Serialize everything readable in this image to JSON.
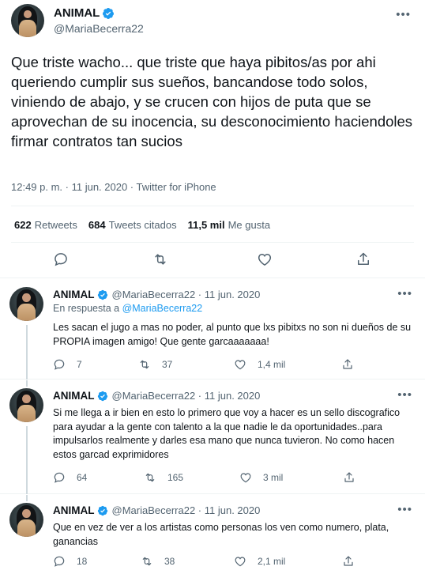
{
  "author": {
    "name": "ANIMAL",
    "handle": "@MariaBecerra22"
  },
  "main_tweet": {
    "text": "Que triste wacho... que triste que haya pibitos/as por ahi queriendo cumplir sus sueños, bancandose todo solos, viniendo de abajo, y se crucen con hijos de puta que se aprovechan de su inocencia, su desconocimiento haciendoles firmar contratos tan sucios",
    "meta": "12:49 p. m. · 11 jun. 2020 · Twitter for iPhone",
    "stats": {
      "retweets_count": "622",
      "retweets_label": "Retweets",
      "quotes_count": "684",
      "quotes_label": "Tweets citados",
      "likes_count": "11,5 mil",
      "likes_label": "Me gusta"
    }
  },
  "replies": [
    {
      "name": "ANIMAL",
      "handle_date": "@MariaBecerra22 · 11 jun. 2020",
      "in_reply_prefix": "En respuesta a",
      "in_reply_handle": "@MariaBecerra22",
      "text": "Les sacan el jugo a mas no poder, al punto que lxs pibitxs no son ni dueños de su PROPIA imagen amigo! Que gente garcaaaaaaa!",
      "replies": "7",
      "retweets": "37",
      "likes": "1,4 mil"
    },
    {
      "name": "ANIMAL",
      "handle_date": "@MariaBecerra22 · 11 jun. 2020",
      "text": "Si me llega a ir bien en esto lo primero que voy a hacer es un sello discografico para ayudar a la gente con talento a la que nadie le da oportunidades..para impulsarlos realmente y darles esa mano que nunca tuvieron. No como hacen estos garcad exprimidores",
      "replies": "64",
      "retweets": "165",
      "likes": "3 mil"
    },
    {
      "name": "ANIMAL",
      "handle_date": "@MariaBecerra22 · 11 jun. 2020",
      "text": "Que en vez de ver a los artistas como personas los ven como numero, plata, ganancias",
      "replies": "18",
      "retweets": "38",
      "likes": "2,1 mil"
    }
  ],
  "icons": {
    "verified": "verified-badge-icon",
    "reply": "reply-icon",
    "retweet": "retweet-icon",
    "like": "heart-icon",
    "share": "share-icon",
    "more": "more-dots-icon"
  },
  "colors": {
    "text": "#0f1419",
    "secondary": "#536471",
    "link": "#1d9bf0",
    "verified": "#1d9bf0",
    "divider": "#eff3f4"
  }
}
